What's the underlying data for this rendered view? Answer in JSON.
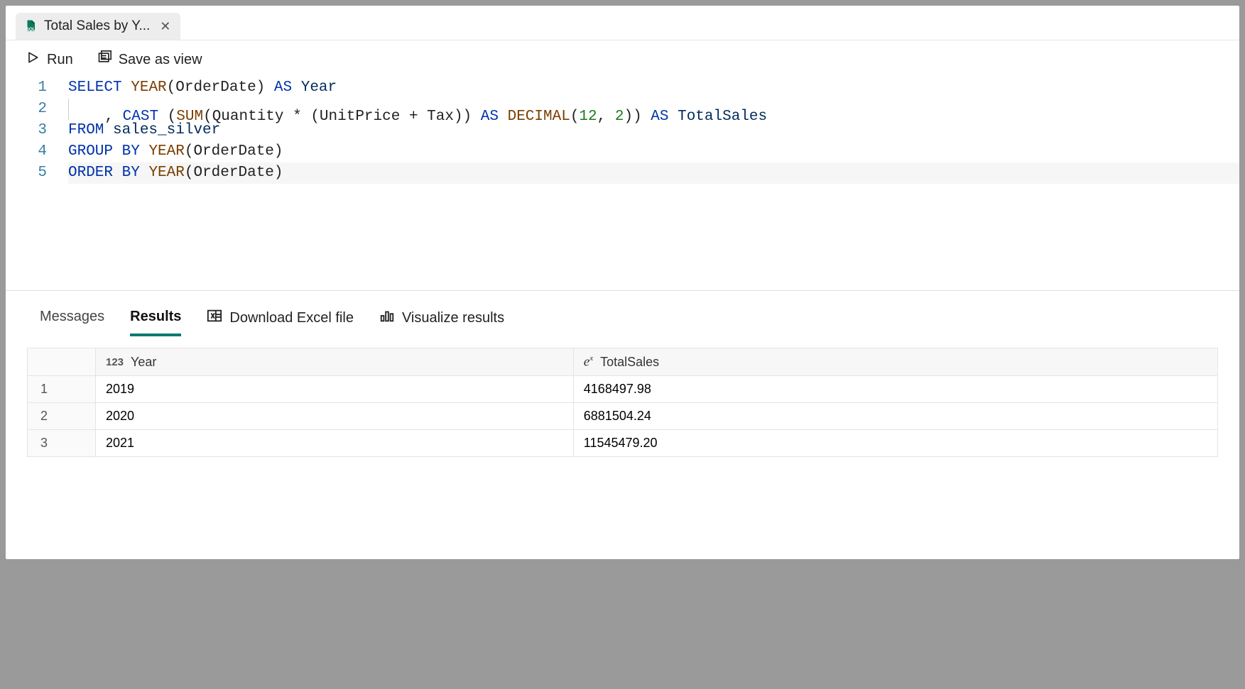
{
  "tab": {
    "title": "Total Sales by Y..."
  },
  "toolbar": {
    "run_label": "Run",
    "save_view_label": "Save as view"
  },
  "editor": {
    "line_numbers": [
      "1",
      "2",
      "3",
      "4",
      "5"
    ],
    "code_lines": [
      {
        "tokens": [
          {
            "t": "SELECT",
            "c": "kw"
          },
          {
            "t": " ",
            "c": "plain"
          },
          {
            "t": "YEAR",
            "c": "fn"
          },
          {
            "t": "(OrderDate) ",
            "c": "plain"
          },
          {
            "t": "AS",
            "c": "kw"
          },
          {
            "t": " ",
            "c": "plain"
          },
          {
            "t": "Year",
            "c": "ident"
          }
        ]
      },
      {
        "indent": true,
        "tokens": [
          {
            "t": ", ",
            "c": "plain"
          },
          {
            "t": "CAST",
            "c": "kw"
          },
          {
            "t": " (",
            "c": "plain"
          },
          {
            "t": "SUM",
            "c": "fn"
          },
          {
            "t": "(Quantity * (UnitPrice + Tax)) ",
            "c": "plain"
          },
          {
            "t": "AS",
            "c": "kw"
          },
          {
            "t": " ",
            "c": "plain"
          },
          {
            "t": "DECIMAL",
            "c": "fn"
          },
          {
            "t": "(",
            "c": "plain"
          },
          {
            "t": "12",
            "c": "num"
          },
          {
            "t": ", ",
            "c": "plain"
          },
          {
            "t": "2",
            "c": "num"
          },
          {
            "t": ")) ",
            "c": "plain"
          },
          {
            "t": "AS",
            "c": "kw"
          },
          {
            "t": " TotalSales",
            "c": "ident"
          }
        ]
      },
      {
        "tokens": [
          {
            "t": "FROM",
            "c": "kw"
          },
          {
            "t": " sales_silver",
            "c": "ident"
          }
        ]
      },
      {
        "tokens": [
          {
            "t": "GROUP",
            "c": "kw"
          },
          {
            "t": " ",
            "c": "plain"
          },
          {
            "t": "BY",
            "c": "kw"
          },
          {
            "t": " ",
            "c": "plain"
          },
          {
            "t": "YEAR",
            "c": "fn"
          },
          {
            "t": "(OrderDate)",
            "c": "plain"
          }
        ]
      },
      {
        "current": true,
        "tokens": [
          {
            "t": "ORDER",
            "c": "kw"
          },
          {
            "t": " ",
            "c": "plain"
          },
          {
            "t": "BY",
            "c": "kw"
          },
          {
            "t": " ",
            "c": "plain"
          },
          {
            "t": "YEAR",
            "c": "fn"
          },
          {
            "t": "(OrderDate)",
            "c": "plain"
          }
        ]
      }
    ]
  },
  "results_bar": {
    "messages_label": "Messages",
    "results_label": "Results",
    "download_label": "Download Excel file",
    "visualize_label": "Visualize results"
  },
  "results": {
    "columns": [
      {
        "type_badge": "123",
        "name": "Year"
      },
      {
        "type_badge": "fx",
        "name": "TotalSales"
      }
    ],
    "rows": [
      {
        "n": "1",
        "cells": [
          "2019",
          "4168497.98"
        ]
      },
      {
        "n": "2",
        "cells": [
          "2020",
          "6881504.24"
        ]
      },
      {
        "n": "3",
        "cells": [
          "2021",
          "11545479.20"
        ]
      }
    ]
  }
}
